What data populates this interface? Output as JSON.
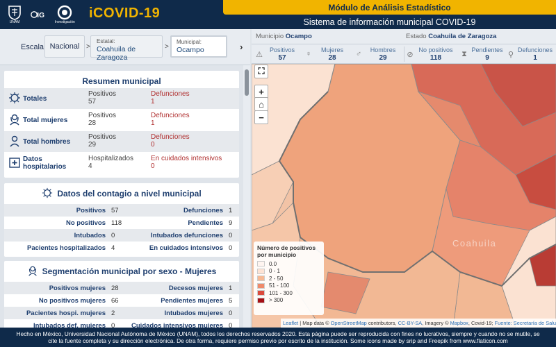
{
  "header": {
    "logos": [
      {
        "icon": "unam-seal-icon",
        "label": "UNAM"
      },
      {
        "icon": "ig-logo-icon",
        "label": "IG"
      },
      {
        "icon": "conacyt-logo-icon",
        "label": "Centro de Investigación"
      }
    ],
    "logo_label_1": "UNAM",
    "logo_label_3": "Investigación",
    "app_title": "iCOVID-19",
    "module": "Módulo de Análisis Estadístico",
    "system_title": "Sistema de información municipal COVID-19"
  },
  "scale": {
    "label": "Escala:",
    "nacional": "Nacional",
    "separator": ">",
    "estatal_caption": "Estatal:",
    "estatal_value": "Coahuila de Zaragoza",
    "municipal_caption": "Municipal:",
    "municipal_value": "Ocampo",
    "next": "›"
  },
  "resumen": {
    "title": "Resumen municipal",
    "rows": [
      {
        "icon": "virus-icon",
        "name": "Totales",
        "c1_label": "Positivos",
        "c1_value": "57",
        "c2_label": "Defunciones",
        "c2_value": "1"
      },
      {
        "icon": "woman-icon",
        "name": "Total mujeres",
        "c1_label": "Positivos",
        "c1_value": "28",
        "c2_label": "Defunciones",
        "c2_value": "1"
      },
      {
        "icon": "man-icon",
        "name": "Total hombres",
        "c1_label": "Positivos",
        "c1_value": "29",
        "c2_label": "Defunciones",
        "c2_value": "0"
      },
      {
        "icon": "hospital-icon",
        "name_line1": "Datos",
        "name_line2": "hospitalarios",
        "c1_label": "Hospitalizados",
        "c1_value": "4",
        "c2_label": "En cuidados intensivos",
        "c2_value": "0"
      }
    ]
  },
  "contagio": {
    "title": "Datos del contagio a nivel municipal",
    "icon": "virus-icon",
    "rows": [
      {
        "l1": "Positivos",
        "v1": "57",
        "l2": "Defunciones",
        "v2": "1"
      },
      {
        "l1": "No positivos",
        "v1": "118",
        "l2": "Pendientes",
        "v2": "9"
      },
      {
        "l1": "Intubados",
        "v1": "0",
        "l2": "Intubados defunciones",
        "v2": "0"
      },
      {
        "l1": "Pacientes hospitalizados",
        "v1": "4",
        "l2": "En cuidados intensivos",
        "v2": "0"
      }
    ]
  },
  "mujeres": {
    "title": "Segmentación municipal por sexo - Mujeres",
    "icon": "woman-icon",
    "rows": [
      {
        "l1": "Positivos mujeres",
        "v1": "28",
        "l2": "Decesos mujeres",
        "v2": "1"
      },
      {
        "l1": "No positivos mujeres",
        "v1": "66",
        "l2": "Pendientes mujeres",
        "v2": "5"
      },
      {
        "l1": "Pacientes hospi. mujeres",
        "v1": "2",
        "l2": "Intubados mujeres",
        "v2": "0"
      },
      {
        "l1": "Intubados def. mujeres",
        "v1": "0",
        "l2": "Cuidados intensivos mujeres",
        "v2": "0"
      }
    ]
  },
  "municipio_header": {
    "municipio_label": "Municipio",
    "municipio_value": "Ocampo",
    "estado_label": "Estado",
    "estado_value": "Coahuila de Zaragoza"
  },
  "stats": [
    {
      "icon": "warning-icon",
      "label": "Positivos",
      "value": "57"
    },
    {
      "icon": "female-symbol-icon",
      "label": "Mujeres",
      "value": "28"
    },
    {
      "icon": "male-symbol-icon",
      "label": "Hombres",
      "value": "29"
    },
    {
      "icon": "no-entry-icon",
      "label": "No positivos",
      "value": "118"
    },
    {
      "icon": "hourglass-icon",
      "label": "Pendientes",
      "value": "9"
    },
    {
      "icon": "person-down-icon",
      "label": "Defunciones",
      "value": "1"
    }
  ],
  "map": {
    "region_label": "Coahuila",
    "controls": [
      {
        "name": "fullscreen-button",
        "glyph": "⛶"
      },
      {
        "name": "zoom-in-button",
        "glyph": "+"
      },
      {
        "name": "home-button",
        "glyph": "⌂"
      },
      {
        "name": "zoom-out-button",
        "glyph": "−"
      }
    ],
    "legend_title": "Número de positivos por municipio",
    "legend": [
      {
        "label": "0.0",
        "color": "#fff5f0"
      },
      {
        "label": "0 - 1",
        "color": "#fde3d4"
      },
      {
        "label": "2 - 50",
        "color": "#f7b993"
      },
      {
        "label": "51 - 100",
        "color": "#ef8a6a"
      },
      {
        "label": "101 - 300",
        "color": "#db4a3c"
      },
      {
        "label": "> 300",
        "color": "#a50f15"
      }
    ],
    "attribution": {
      "leaflet": "Leaflet",
      "text1": " | Map data © ",
      "osm": "OpenStreetMap",
      "text2": " contributors, ",
      "ccbysa": "CC-BY-SA",
      "text3": ", Imagery © ",
      "mapbox": "Mapbox",
      "text4": ", Covid-19; ",
      "fuente": "Fuente: Secretaría de Salud 2020"
    }
  },
  "footer": {
    "text": "Hecho en México, Universidad Nacional Autónoma de México (UNAM), todos los derechos reservados 2020. Esta página puede ser reproducida con fines no lucrativos, siempre y cuando no se mutile, se cite la fuente completa y su dirección electrónica. De otra forma, requiere permiso previo por escrito de la institución. Some icons made by srip and Freepik from www.flaticon.com"
  }
}
